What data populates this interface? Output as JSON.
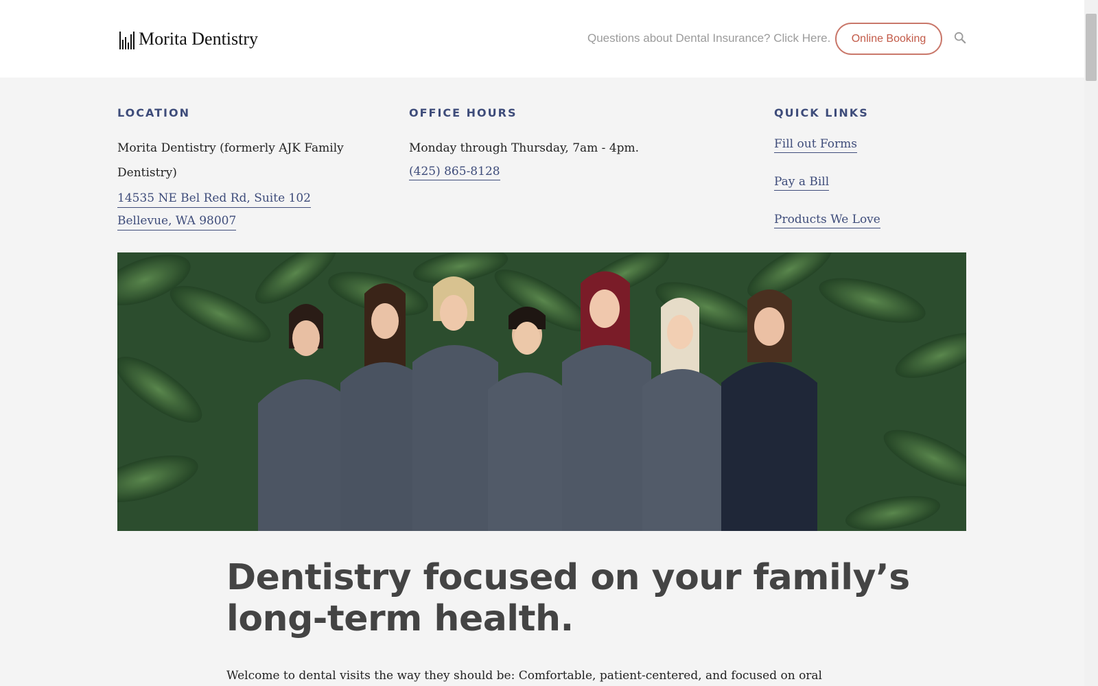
{
  "header": {
    "logo_text": "Morita Dentistry",
    "insurance_link": "Questions about Dental Insurance? Click Here.",
    "booking_label": "Online Booking",
    "search_icon": "search-icon"
  },
  "info": {
    "location": {
      "heading": "LOCATION",
      "practice_name": "Morita Dentistry (formerly AJK Family Dentistry)",
      "address_line1": "14535 NE Bel Red Rd, Suite 102",
      "address_line2": "Bellevue, WA 98007"
    },
    "hours": {
      "heading": "OFFICE HOURS",
      "schedule": "Monday through Thursday, 7am - 4pm.",
      "phone": "(425) 865-8128"
    },
    "quick_links": {
      "heading": "QUICK LINKS",
      "links": [
        "Fill out Forms",
        "Pay a Bill",
        "Products We Love"
      ]
    }
  },
  "main": {
    "headline": "Dentistry focused on your family’s long-term health.",
    "intro": "Welcome to dental visits the way they should be: Comfortable, patient-centered, and focused on oral"
  },
  "colors": {
    "accent": "#3e4c7a",
    "button": "#c25a48",
    "background": "#f4f4f4"
  }
}
